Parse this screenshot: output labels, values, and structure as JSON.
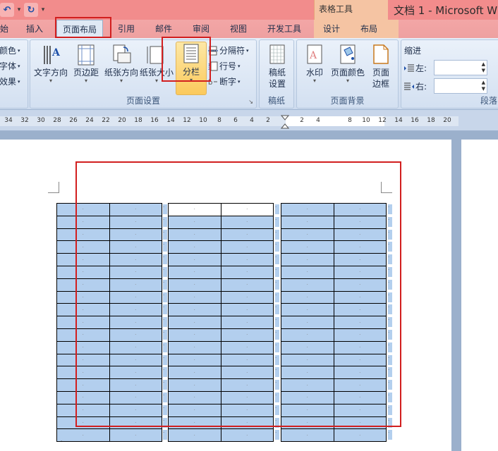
{
  "title_bar": {
    "document_title": "文档 1 - Microsoft W",
    "context_tool_title": "表格工具",
    "qat": {
      "undo_icon": "undo-icon",
      "redo_icon": "redo-icon"
    }
  },
  "tabs": [
    {
      "label": "始"
    },
    {
      "label": "插入"
    },
    {
      "label": "页面布局"
    },
    {
      "label": "引用"
    },
    {
      "label": "邮件"
    },
    {
      "label": "审阅"
    },
    {
      "label": "视图"
    },
    {
      "label": "开发工具"
    },
    {
      "label": "设计"
    },
    {
      "label": "布局"
    }
  ],
  "ribbon": {
    "theme_group": {
      "colors": "颜色",
      "fonts": "字体",
      "effects": "效果"
    },
    "page_setup": {
      "label": "页面设置",
      "text_direction": "文字方向",
      "margins": "页边距",
      "orientation": "纸张方向",
      "size": "纸张大小",
      "columns": "分栏",
      "breaks": "分隔符",
      "line_numbers": "行号",
      "hyphenation": "断字"
    },
    "manuscript": {
      "label": "稿纸",
      "btn_line1": "稿纸",
      "btn_line2": "设置"
    },
    "page_background": {
      "label": "页面背景",
      "watermark": "水印",
      "page_color": "页面颜色",
      "page_borders_line1": "页面",
      "page_borders_line2": "边框"
    },
    "paragraph": {
      "label": "段落",
      "indent": "缩进",
      "left": "左:",
      "right": "右:"
    }
  },
  "ruler": {
    "ticks": [
      "34",
      "32",
      "30",
      "28",
      "26",
      "24",
      "22",
      "20",
      "18",
      "16",
      "14",
      "12",
      "10",
      "8",
      "6",
      "4",
      "2",
      "2",
      "4",
      "8",
      "10",
      "12",
      "14",
      "16",
      "18",
      "20"
    ]
  },
  "document": {
    "cell_mark": "·",
    "row_end_mark": "·",
    "paragraph_mark": "·"
  }
}
